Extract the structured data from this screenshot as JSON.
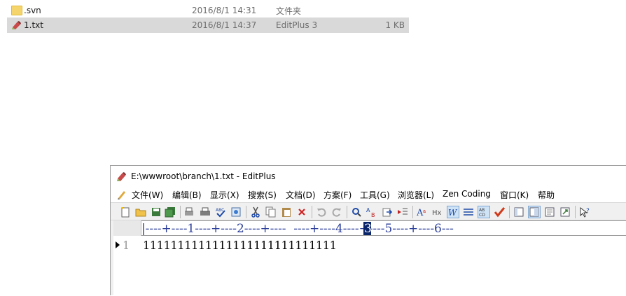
{
  "explorer": {
    "files": [
      {
        "name": ".svn",
        "date": "2016/8/1 14:31",
        "type": "文件夹",
        "size": "",
        "icon": "folder-icon",
        "selected": false
      },
      {
        "name": "1.txt",
        "date": "2016/8/1 14:37",
        "type": "EditPlus 3",
        "size": "1 KB",
        "icon": "editplus-file-icon",
        "selected": true
      }
    ]
  },
  "editplus": {
    "title": "E:\\wwwroot\\branch\\1.txt - EditPlus",
    "menu": [
      "文件(W)",
      "编辑(B)",
      "显示(X)",
      "搜索(S)",
      "文档(D)",
      "方案(F)",
      "工具(G)",
      "浏览器(L)",
      "Zen Coding",
      "窗口(K)",
      "帮助"
    ],
    "toolbar": [
      "new-file-icon",
      "open-folder-icon",
      "save-icon",
      "save-all-icon",
      "print-preview-icon",
      "print-icon",
      "spell-check-icon",
      "browser-preview-icon",
      "cut-icon",
      "copy-icon",
      "paste-icon",
      "delete-icon",
      "undo-icon",
      "redo-icon",
      "find-icon",
      "replace-icon",
      "goto-icon",
      "indent-icon",
      "font-icon",
      "hex-icon",
      "word-wrap-icon",
      "line-number-icon",
      "column-icon",
      "check-icon",
      "view1-icon",
      "view2-icon",
      "view3-icon",
      "view4-icon",
      "help-icon"
    ],
    "ruler": "|----+----1----+----2----+----",
    "ruler_cursor": "3",
    "ruler_after": "----+----4----+----5----+----6---",
    "line_number": "1",
    "line_text": "1111111111111111111111111111",
    "colors": {
      "ruler": "#2a3d99",
      "cursor_bg": "#0a246a",
      "selection": "#d9d9d9"
    }
  }
}
